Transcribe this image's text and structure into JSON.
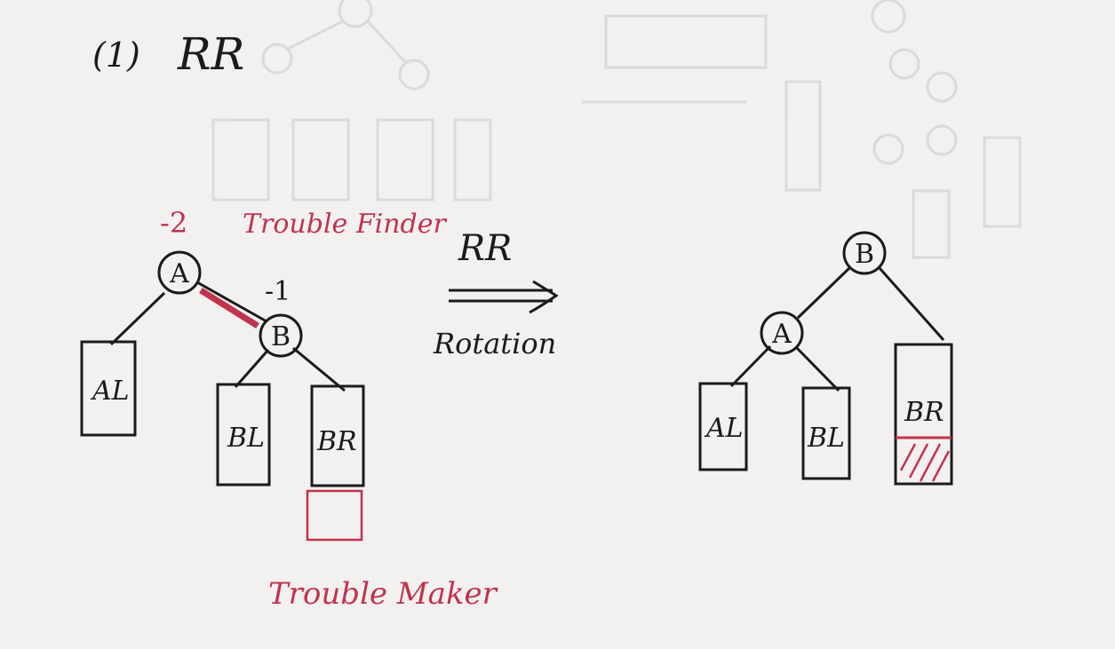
{
  "heading": {
    "number": "(1)",
    "title": "RR"
  },
  "colors": {
    "ink": "#1b1b1b",
    "red": "#c2334d",
    "paper": "#f2f1ef",
    "ghost": "#d9d8d6"
  },
  "before": {
    "node_a": "A",
    "node_b": "B",
    "balance_a": "-2",
    "balance_b": "-1",
    "trouble_finder": "Trouble Finder",
    "subtree_al": "AL",
    "subtree_bl": "BL",
    "subtree_br": "BR",
    "trouble_maker": "Trouble Maker"
  },
  "transition": {
    "label": "RR",
    "sublabel": "Rotation"
  },
  "after": {
    "node_b": "B",
    "node_a": "A",
    "subtree_al": "AL",
    "subtree_bl": "BL",
    "subtree_br": "BR"
  }
}
